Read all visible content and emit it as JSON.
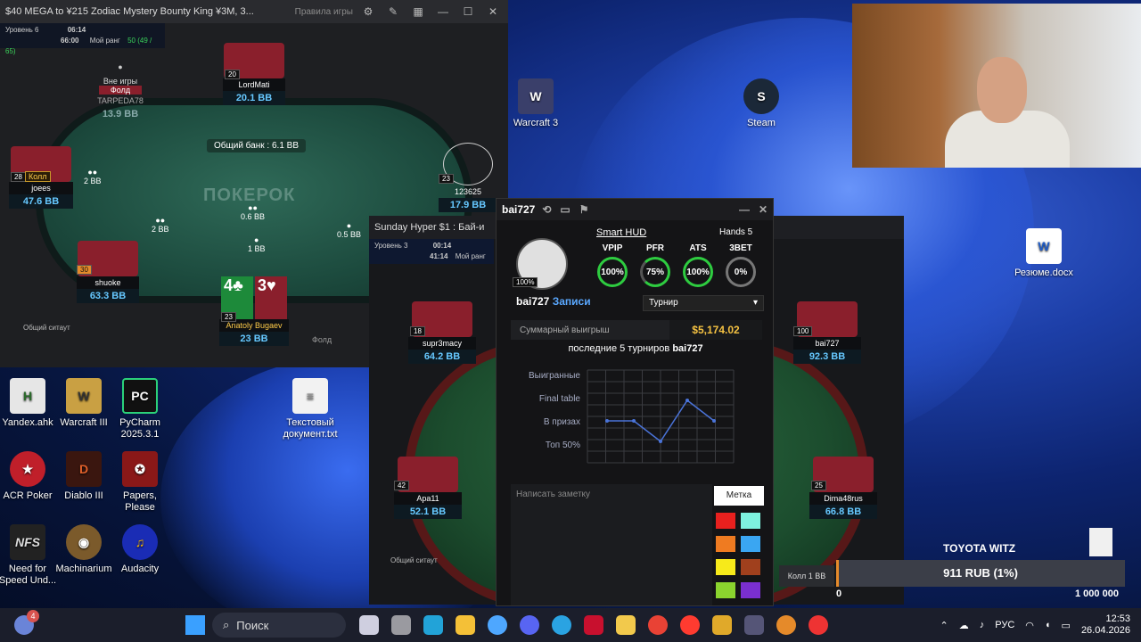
{
  "desktop": {
    "icons": [
      {
        "label": "Warcraft 3"
      },
      {
        "label": "Steam"
      },
      {
        "label": "Резюме.docx"
      },
      {
        "label": "Текстовый документ.txt"
      },
      {
        "label": "Yandex.ahk"
      },
      {
        "label": "Warcraft III"
      },
      {
        "label": "PyCharm 2025.3.1"
      },
      {
        "label": "ACR Poker"
      },
      {
        "label": "Diablo III"
      },
      {
        "label": "Papers, Please"
      },
      {
        "label": "Need for Speed Und..."
      },
      {
        "label": "Machinarium"
      },
      {
        "label": "Audacity"
      }
    ]
  },
  "win1": {
    "title": "$40 MEGA to ¥215 Zodiac Mystery Bounty King ¥3M, 3...",
    "rules_link": "Правила игры",
    "level": "Уровень 6",
    "time1": "06:14",
    "time2": "66:00",
    "my_rank_label": "Мой ранг",
    "my_rank": "50 (49 / 65)",
    "pot": "Общий банк : 6.1 BB",
    "watermark": "ПОКЕРОК",
    "fold_btn": "Фолд",
    "sitout": "Общий ситаут",
    "players": [
      {
        "name": "LordMati",
        "stack": "20.1 BB",
        "badge": "20"
      },
      {
        "name": "TARPEDA78",
        "stack": "13.9 BB",
        "status": "Вне игры",
        "action": "Фолд"
      },
      {
        "name": "joees",
        "stack": "47.6 BB",
        "badge": "28",
        "action": "Колл"
      },
      {
        "name": "123625",
        "stack": "17.9 BB",
        "badge": "23"
      },
      {
        "name": "shuoke",
        "stack": "63.3 BB",
        "badge": "30"
      },
      {
        "name": "Anatoly Bugaev",
        "stack": "23 BB",
        "badge": "23"
      }
    ],
    "bets": [
      "2 BB",
      "2 BB",
      "0.6 BB",
      "1 BB",
      "0.5 BB"
    ]
  },
  "win2": {
    "title": "Sunday Hyper $1 : Бай-и",
    "level": "Уровень 3",
    "time1": "00:14",
    "time2": "41:14",
    "my_rank_label": "Мой ранг",
    "sitout": "Общий ситаут",
    "call_btn": "Колл 1 BB",
    "players": [
      {
        "name": "supr3macy",
        "stack": "64.2 BB",
        "badge": "18"
      },
      {
        "name": "bai727",
        "stack": "92.3 BB",
        "badge": "100"
      },
      {
        "name": "Apa11",
        "stack": "52.1 BB",
        "badge": "42"
      },
      {
        "name": "Dima48rus",
        "stack": "66.8 BB",
        "badge": "25"
      }
    ]
  },
  "hud": {
    "player": "bai727",
    "smart_hud": "Smart HUD",
    "hands": "Hands 5",
    "records": "Записи",
    "avatar_badge": "100%",
    "stats": [
      {
        "label": "VPIP",
        "value": "100%"
      },
      {
        "label": "PFR",
        "value": "75%"
      },
      {
        "label": "ATS",
        "value": "100%"
      },
      {
        "label": "3BET",
        "value": "0%"
      }
    ],
    "mode": "Турнир",
    "sum_label": "Суммарный выигрыш",
    "sum_value": "$5,174.02",
    "last_label": "последние 5 турниров",
    "rows": [
      "Выигранные",
      "Final table",
      "В призах",
      "Топ 50%"
    ],
    "note_placeholder": "Написать заметку",
    "tag_label": "Метка",
    "swatches": [
      "#e8201e",
      "#7ef2df",
      "#ef7b21",
      "#3aa6f2",
      "#f7ea1a",
      "#a0401d",
      "#8bd42e",
      "#7a2fd0"
    ]
  },
  "chart_data": {
    "type": "line",
    "categories": [
      "1",
      "2",
      "3",
      "4",
      "5"
    ],
    "series": [
      {
        "values": [
          1,
          1,
          0,
          2,
          1
        ]
      }
    ],
    "ylim": [
      0,
      4
    ]
  },
  "stream": {
    "car": "TOYOTA WITZ",
    "progress_text": "911 RUB (1%)",
    "progress": 0.01,
    "min": "0",
    "max": "1 000 000"
  },
  "taskbar": {
    "search": "Поиск",
    "lang": "РУС",
    "time": "12:53",
    "date": "26.04.2026",
    "notif_count": "4"
  }
}
